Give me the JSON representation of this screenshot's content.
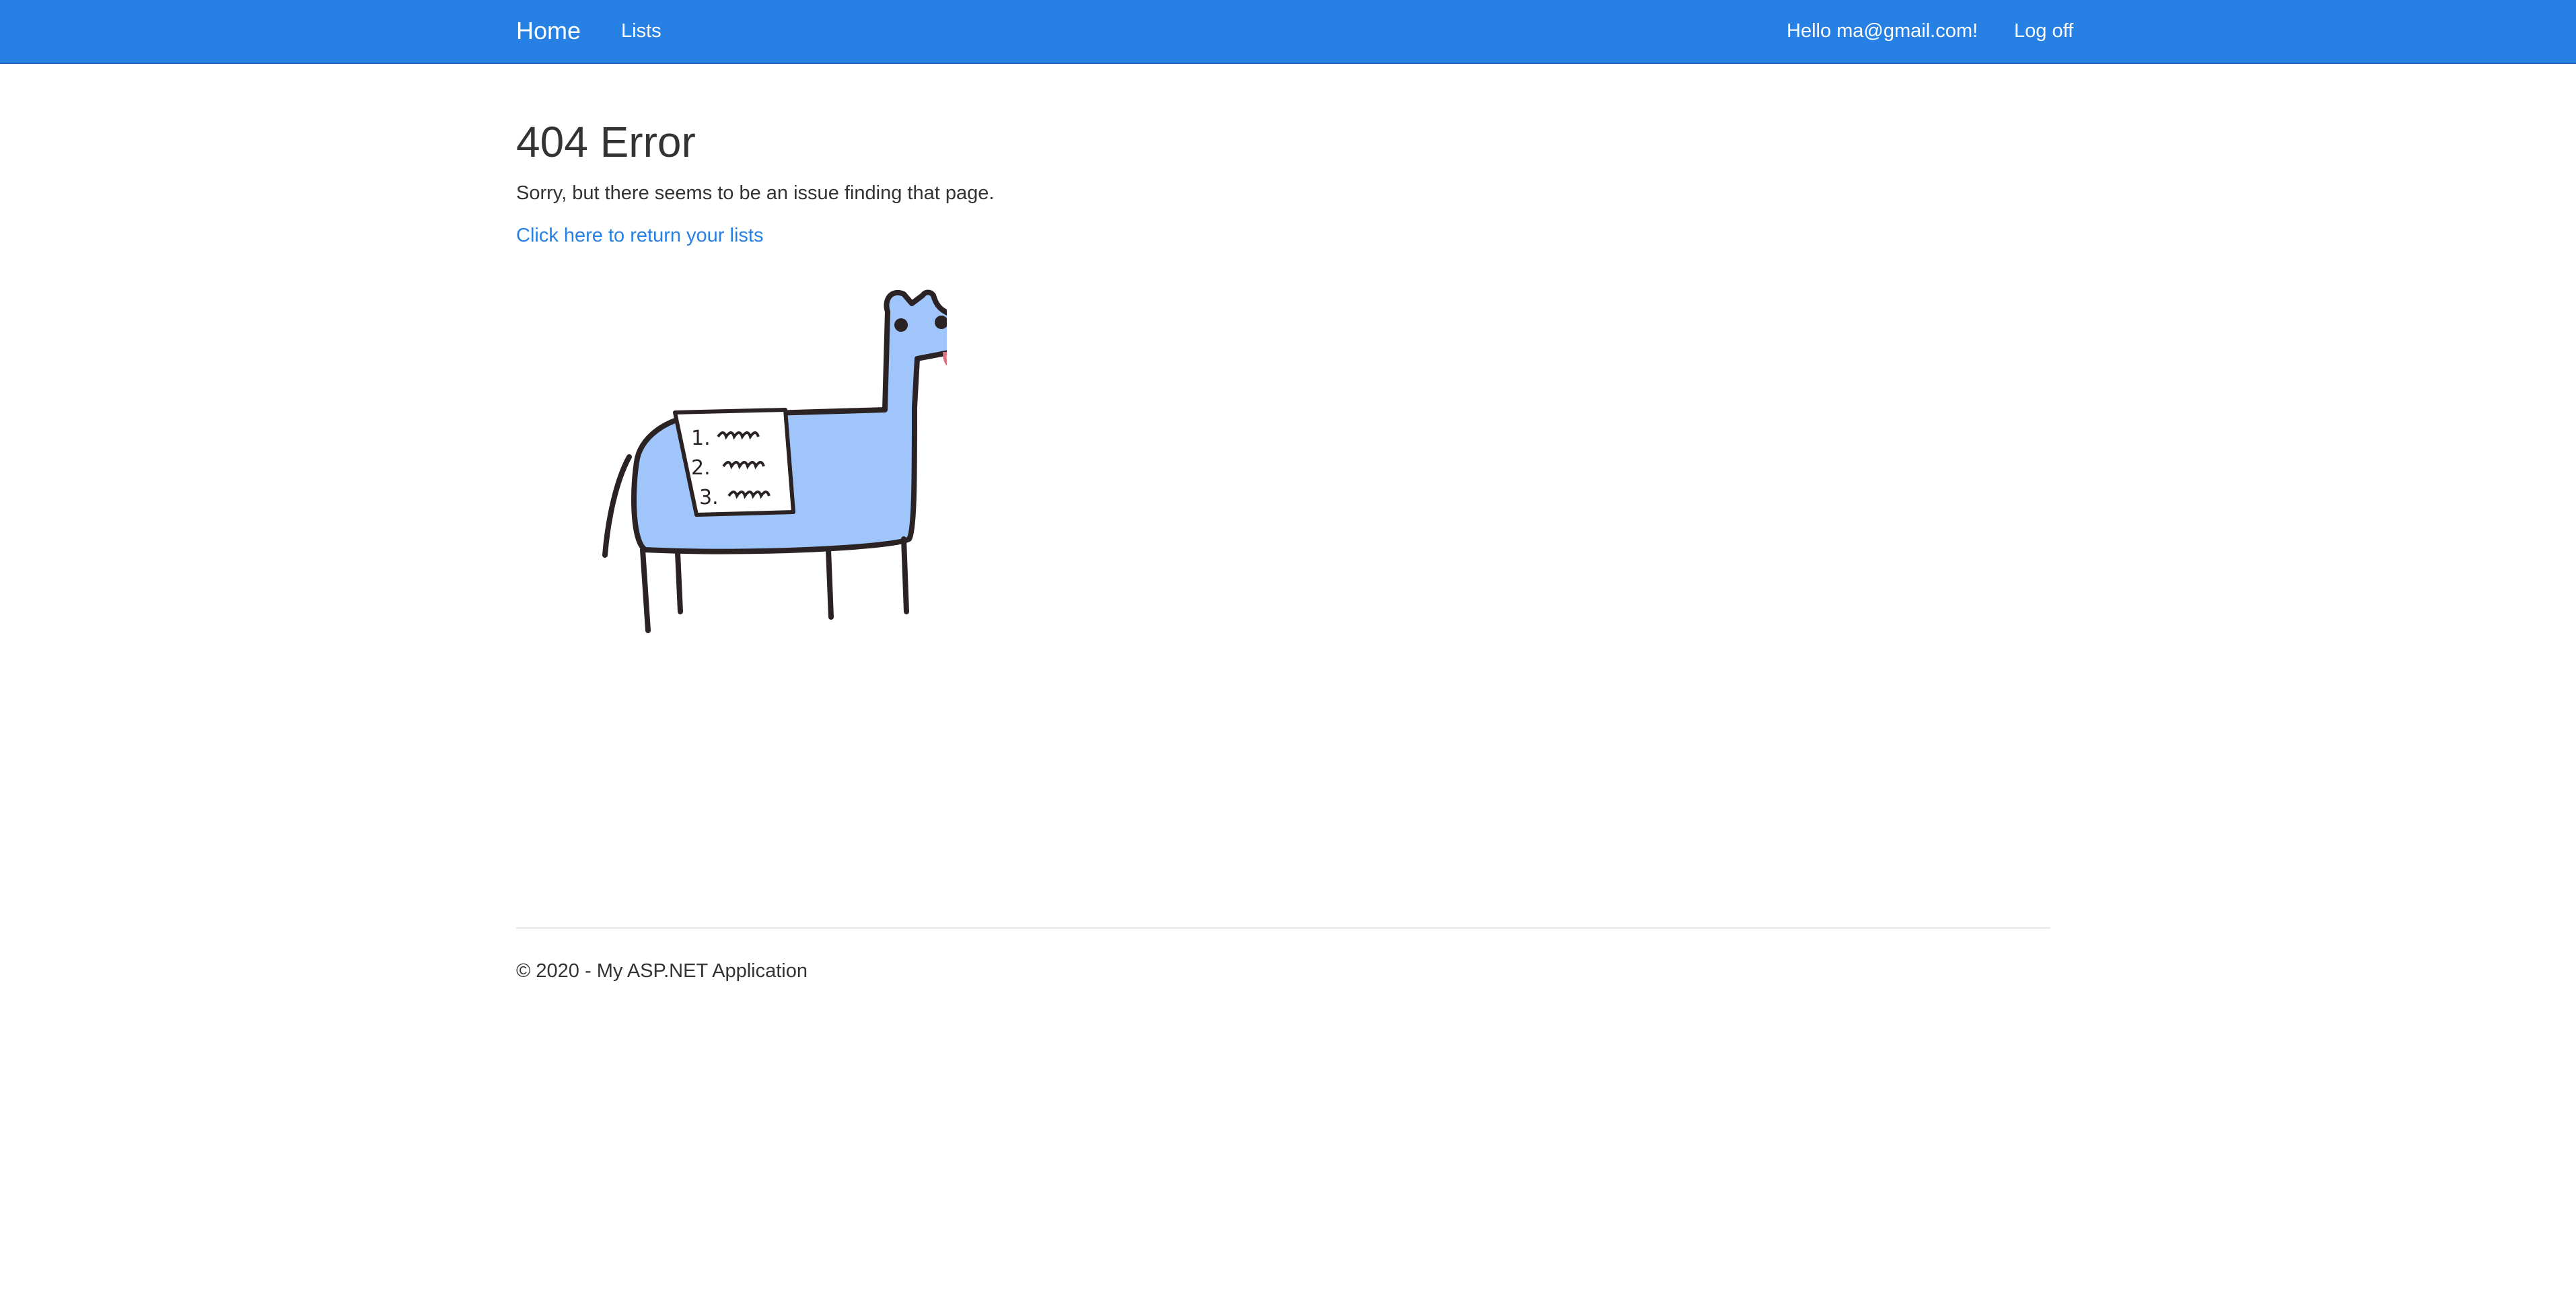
{
  "navbar": {
    "brand": "Home",
    "links": [
      {
        "label": "Lists"
      }
    ],
    "user_greeting": "Hello ma@gmail.com!",
    "logoff_label": "Log off",
    "background_color": "#2780e3"
  },
  "main": {
    "title": "404 Error",
    "message": "Sorry, but there seems to be an issue finding that page.",
    "return_link": "Click here to return your lists",
    "illustration": {
      "icon": "llama-with-list-illustration",
      "list_items": [
        "1.",
        "2.",
        "3."
      ]
    }
  },
  "footer": {
    "text": "© 2020 - My ASP.NET Application"
  }
}
